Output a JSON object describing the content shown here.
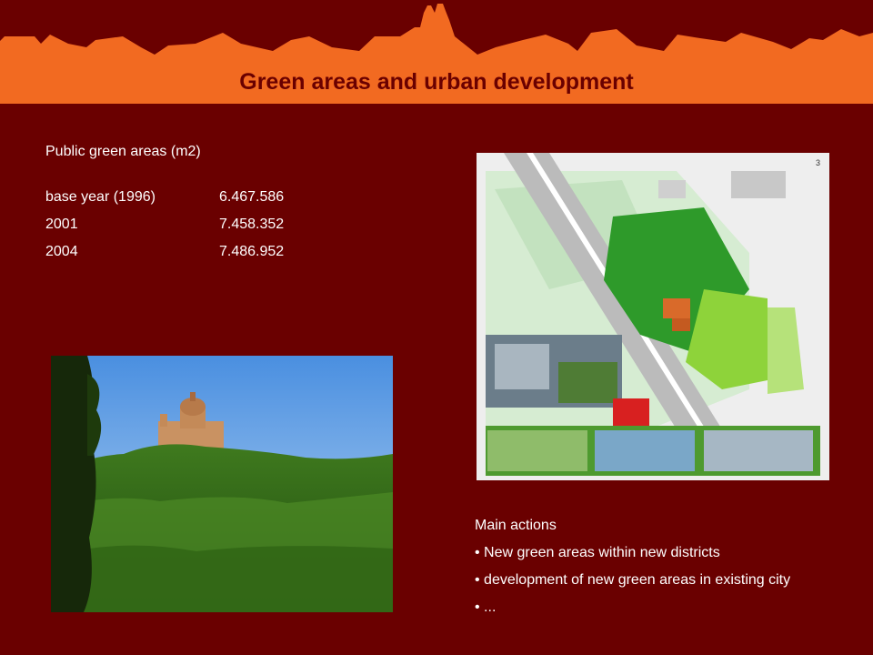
{
  "header": {
    "title": "Green areas and urban development"
  },
  "stats": {
    "heading": "Public green areas (m2)",
    "rows": [
      {
        "label": "base year (1996)",
        "value": "6.467.586"
      },
      {
        "label": "2001",
        "value": "7.458.352"
      },
      {
        "label": "2004",
        "value": "7.486.952"
      }
    ]
  },
  "actions": {
    "heading": "Main actions",
    "items": [
      "New green areas within new districts",
      "development of new green areas in existing city",
      "..."
    ]
  },
  "plan_image": {
    "caption": "3"
  },
  "colors": {
    "background": "#6a0000",
    "banner": "#f26a21",
    "text": "#ffffff"
  }
}
